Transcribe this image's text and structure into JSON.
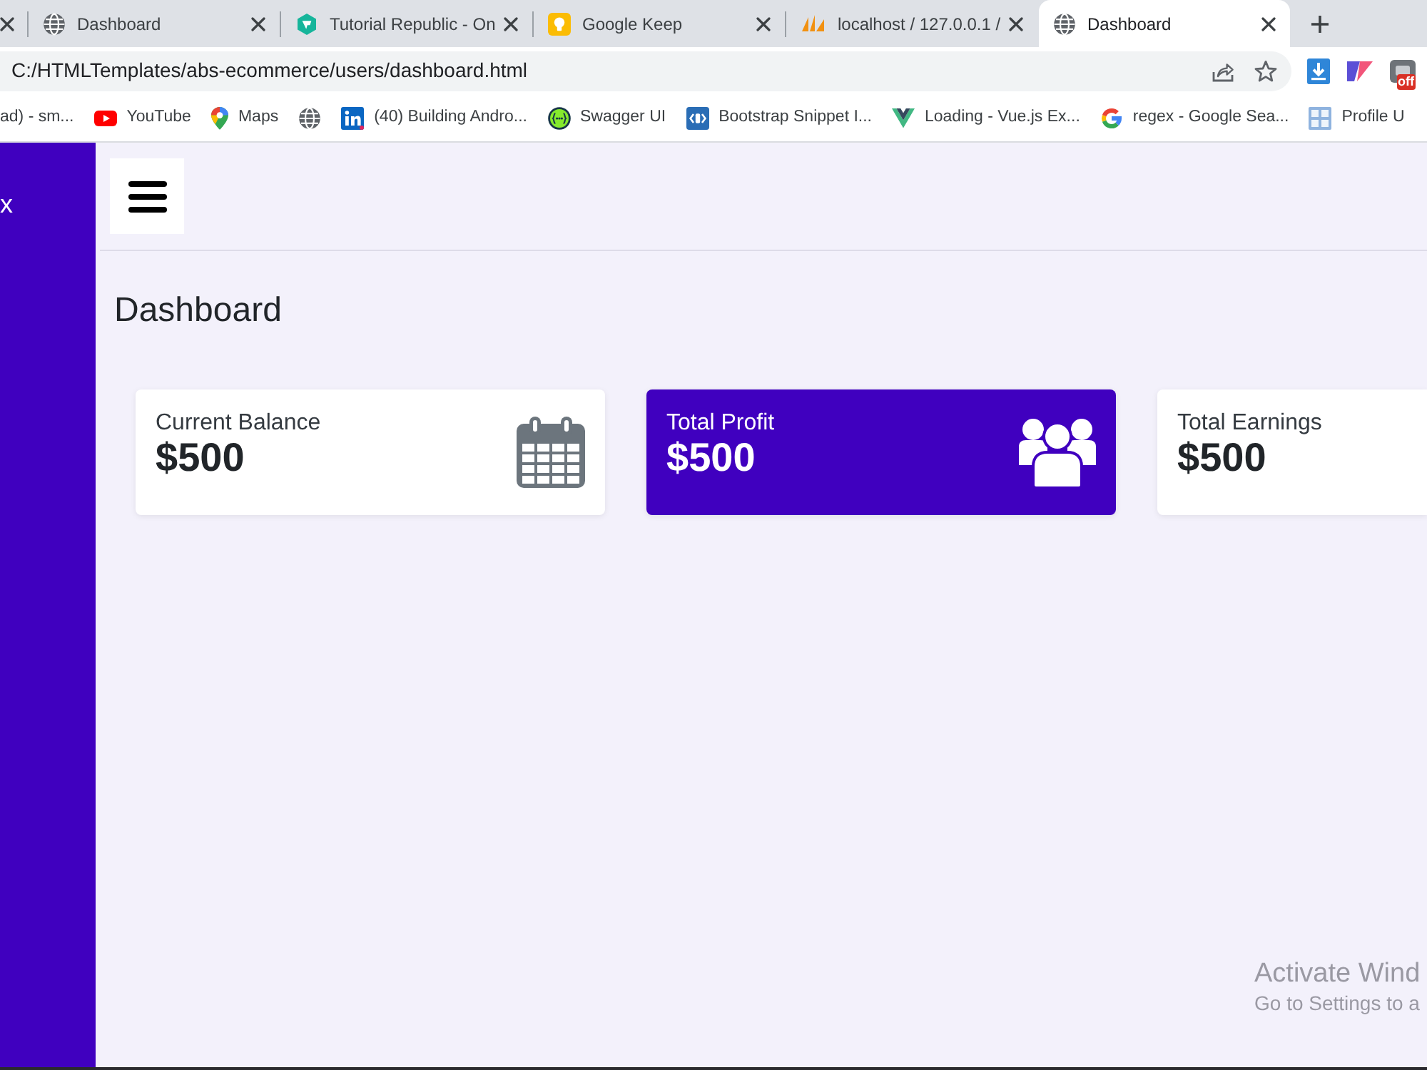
{
  "browser": {
    "tabs": [
      {
        "kind": "cut",
        "selected": false
      },
      {
        "kind": "globe",
        "title": "Dashboard",
        "selected": false
      },
      {
        "kind": "hexagon",
        "title": "Tutorial Republic - On",
        "selected": false
      },
      {
        "kind": "bulb",
        "title": "Google Keep",
        "selected": false
      },
      {
        "kind": "sail",
        "title": "localhost / 127.0.0.1 /",
        "selected": false
      },
      {
        "kind": "globe",
        "title": "Dashboard",
        "selected": true
      }
    ],
    "address_bar": {
      "value": "C:/HTMLTemplates/abs-ecommerce/users/dashboard.html"
    },
    "extensions": [
      {
        "kind": "download"
      },
      {
        "kind": "flag"
      },
      {
        "kind": "tile",
        "badge": "off"
      }
    ],
    "bookmarks": [
      {
        "kind": "none",
        "label": "ad) - sm..."
      },
      {
        "kind": "play",
        "label": "YouTube"
      },
      {
        "kind": "pin",
        "label": "Maps"
      },
      {
        "kind": "globe"
      },
      {
        "kind": "in",
        "label": "(40) Building Andro..."
      },
      {
        "kind": "braces",
        "label": "Swagger UI"
      },
      {
        "kind": "code",
        "label": "Bootstrap Snippet I..."
      },
      {
        "kind": "v",
        "label": "Loading - Vue.js Ex..."
      },
      {
        "kind": "g",
        "label": "regex - Google Sea..."
      },
      {
        "kind": "grid",
        "label": "Profile U"
      }
    ]
  },
  "sidebar": {
    "brand": "x"
  },
  "page": {
    "heading": "Dashboard",
    "cards": [
      {
        "kind": "calendar",
        "title": "Current Balance",
        "value": "$500",
        "highlighted": false
      },
      {
        "kind": "users",
        "title": "Total Profit",
        "value": "$500",
        "highlighted": true
      },
      {
        "kind": "plain",
        "title": "Total Earnings",
        "value": "$500",
        "highlighted": false
      }
    ]
  },
  "os_notice": {
    "title": "Activate Wind",
    "text": "Go to Settings to a"
  }
}
